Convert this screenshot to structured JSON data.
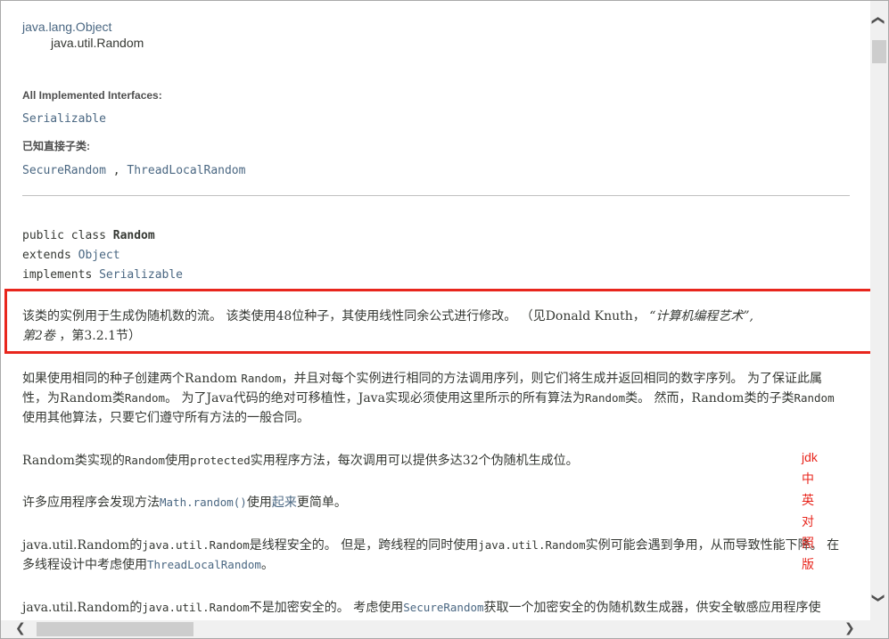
{
  "inheritance": {
    "parent": "java.lang.Object",
    "child": "java.util.Random"
  },
  "interfaces": {
    "label": "All Implemented Interfaces:",
    "items": [
      "Serializable"
    ]
  },
  "subclasses": {
    "label": "已知直接子类:",
    "item1": "SecureRandom",
    "sep": " , ",
    "item2": "ThreadLocalRandom"
  },
  "signature": {
    "line1_kw": "public class ",
    "line1_name": "Random",
    "line2_kw": "extends ",
    "line2_link": "Object",
    "line3_kw": "implements ",
    "line3_link": "Serializable"
  },
  "description": {
    "p1_a": "该类的实例用于生成伪随机数的流。 该类使用48位种子，其使用线性同余公式进行修改。 （见Donald Knuth，",
    "p1_b": "“计算机编程艺术”,",
    "p1_c": "第2卷",
    "p1_d": " ，第3.2.1节）",
    "p2_a": "如果使用相同的种子创建两个Random ",
    "p2_code1": "Random",
    "p2_b": "，并且对每个实例进行相同的方法调用序列，则它们将生成并返回相同的数字序列。 为了保证此属性，为Random类",
    "p2_code2": "Random",
    "p2_c": "。 为了Java代码的绝对可移植性，Java实现必须使用这里所示的所有算法为",
    "p2_code3": "Random",
    "p2_d": "类。 然而，Random类的子类",
    "p2_code4": "Random",
    "p2_e": "使用其他算法，只要它们遵守所有方法的一般合同。",
    "p3_a": "Random类实现的",
    "p3_code1": "Random",
    "p3_b": "使用",
    "p3_code2": "protected",
    "p3_c": "实用程序方法，每次调用可以提供多达32个伪随机生成位。",
    "p4_a": "许多应用程序会发现方法",
    "p4_code1": "Math.random()",
    "p4_b": "使用",
    "p4_link": "起来",
    "p4_c": "更简单。",
    "p5_a": "java.util.Random的",
    "p5_code1": "java.util.Random",
    "p5_b": "是线程安全的。 但是，跨线程的同时使用",
    "p5_code2": "java.util.Random",
    "p5_c": "实例可能会遇到争用，从而导致性能下降。 在多线程设计中考虑使用",
    "p5_code3": "ThreadLocalRandom",
    "p5_d": "。",
    "p6_a": "java.util.Random的",
    "p6_code1": "java.util.Random",
    "p6_b": "不是加密安全的。 考虑使用",
    "p6_code2": "SecureRandom",
    "p6_c": "获取一个加密安全的伪随机数生成器，供安全敏感应用程序使用。"
  },
  "annotation": {
    "chars": [
      "jdk",
      "中",
      "英",
      "对",
      "照",
      "版"
    ],
    "color": "#e8261d"
  },
  "colors": {
    "link": "#4a6782",
    "text": "#353833",
    "highlight": "#e8261d"
  }
}
